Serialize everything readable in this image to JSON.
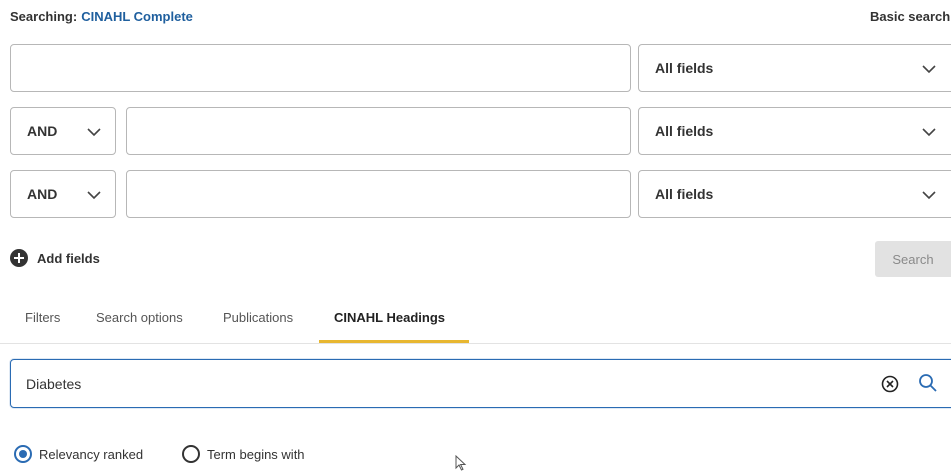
{
  "header": {
    "searching_label": "Searching:",
    "database": "CINAHL Complete",
    "basic_search": "Basic search"
  },
  "search_rows": [
    {
      "boolean": "",
      "term": "",
      "field": "All fields"
    },
    {
      "boolean": "AND",
      "term": "",
      "field": "All fields"
    },
    {
      "boolean": "AND",
      "term": "",
      "field": "All fields"
    }
  ],
  "actions": {
    "add_fields": "Add fields",
    "search": "Search"
  },
  "tabs": [
    {
      "label": "Filters",
      "active": false
    },
    {
      "label": "Search options",
      "active": false
    },
    {
      "label": "Publications",
      "active": false
    },
    {
      "label": "CINAHL Headings",
      "active": true
    }
  ],
  "headings_search": {
    "value": "Diabetes"
  },
  "options": [
    {
      "label": "Relevancy ranked",
      "checked": true
    },
    {
      "label": "Term begins with",
      "checked": false
    }
  ],
  "colors": {
    "accent_blue": "#2a6bb3",
    "link_blue": "#1f5f9e",
    "tab_underline": "#e8b730"
  }
}
